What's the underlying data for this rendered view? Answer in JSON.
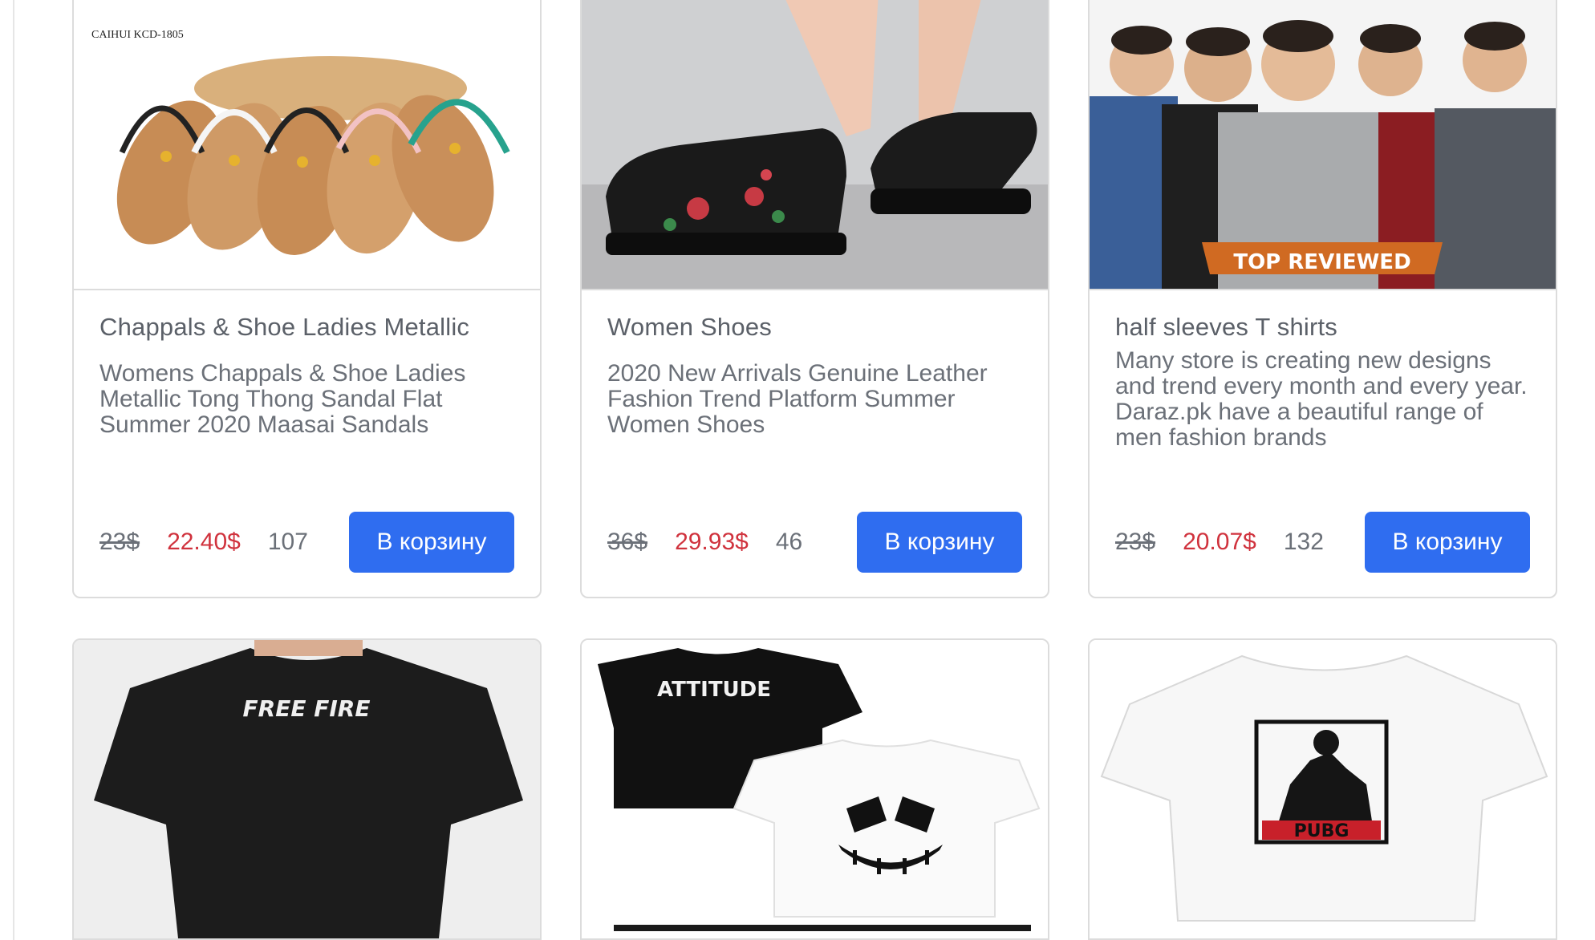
{
  "products": [
    {
      "image_label": "CAIHUI KCD-1805",
      "title": "Chappals & Shoe Ladies Metallic",
      "description": "Womens Chappals & Shoe Ladies Metallic Tong Thong Sandal Flat Summer 2020 Maasai Sandals",
      "old_price": "23$",
      "price": "22.40$",
      "stock": "107",
      "button": "В корзину"
    },
    {
      "title": "Women Shoes",
      "description": "2020 New Arrivals Genuine Leather Fashion Trend Platform Summer Women Shoes",
      "old_price": "36$",
      "price": "29.93$",
      "stock": "46",
      "button": "В корзину"
    },
    {
      "image_label": "TOP REVIEWED",
      "title": "half sleeves T shirts",
      "description": "Many store is creating new designs and trend every month and every year. Daraz.pk have a beautiful range of men fashion brands",
      "old_price": "23$",
      "price": "20.07$",
      "stock": "132",
      "button": "В корзину"
    },
    {
      "image_label": "FREE FIRE"
    },
    {
      "image_label": "ATTITUDE"
    },
    {
      "image_label": "PUBG"
    }
  ],
  "colors": {
    "button": "#2f6df0",
    "price": "#d0323d",
    "text": "#6b7078",
    "border": "#dcdcdc"
  }
}
